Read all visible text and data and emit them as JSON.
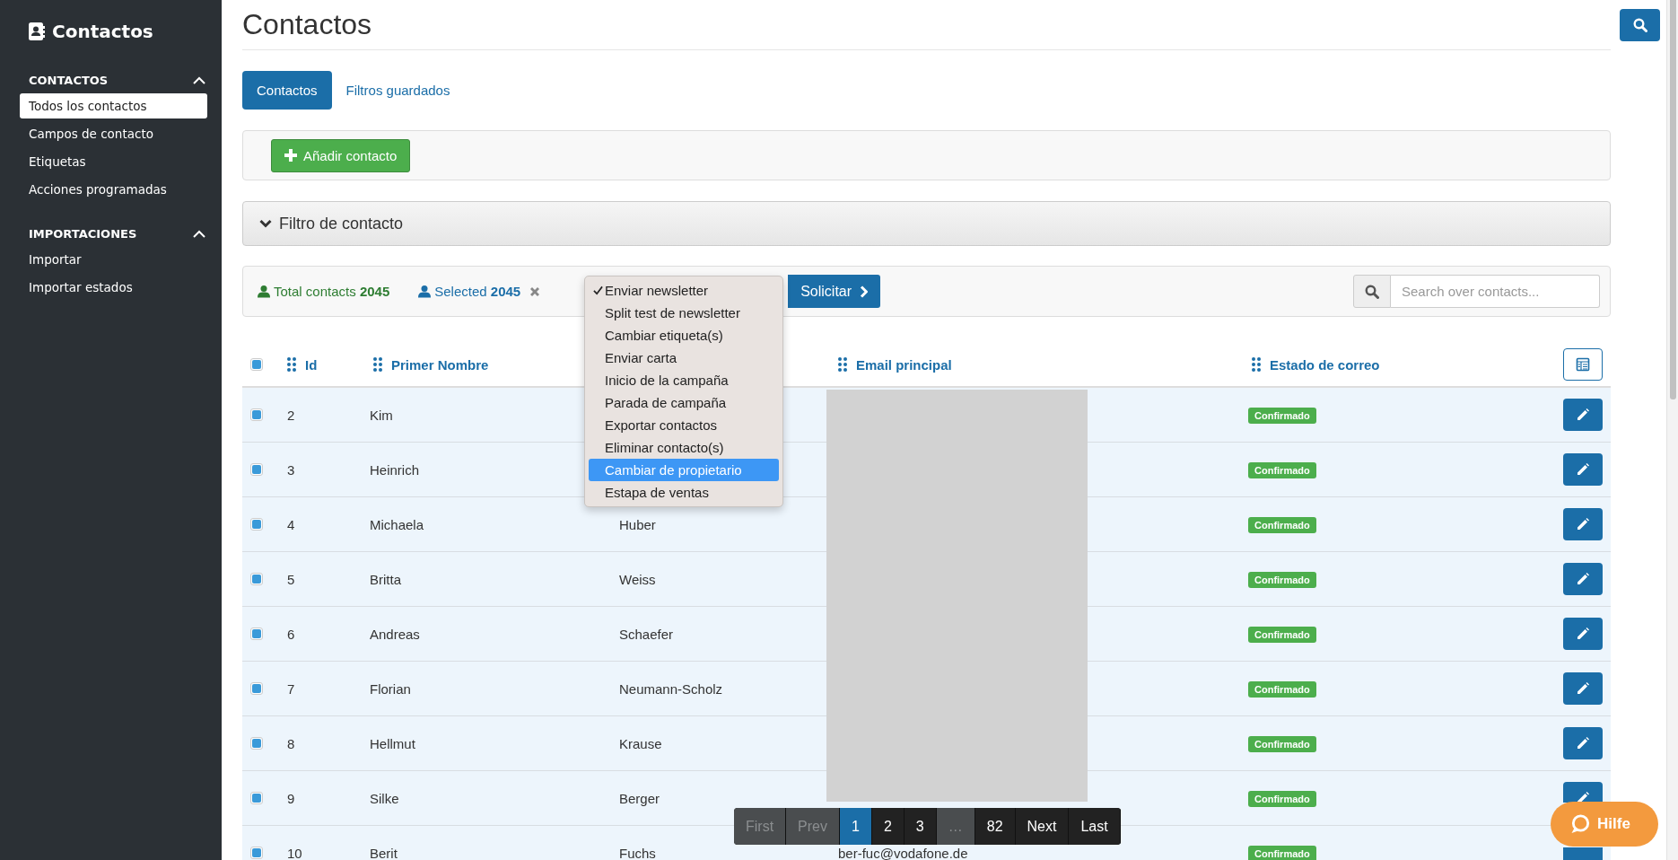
{
  "sidebar": {
    "title": "Contactos",
    "sections": [
      {
        "title": "CONTACTOS",
        "expanded": true,
        "items": [
          {
            "label": "Todos los contactos",
            "selected": true
          },
          {
            "label": "Campos de contacto",
            "selected": false
          },
          {
            "label": "Etiquetas",
            "selected": false
          },
          {
            "label": "Acciones programadas",
            "selected": false
          }
        ]
      },
      {
        "title": "IMPORTACIONES",
        "expanded": true,
        "items": [
          {
            "label": "Importar",
            "selected": false
          },
          {
            "label": "Importar estados",
            "selected": false
          }
        ]
      }
    ]
  },
  "page": {
    "title": "Contactos"
  },
  "tabs": [
    {
      "label": "Contactos",
      "selected": true
    },
    {
      "label": "Filtros guardados",
      "selected": false
    }
  ],
  "add_button": "Añadir contacto",
  "filter_panel": {
    "title": "Filtro de contacto",
    "expanded": false
  },
  "toolbar": {
    "total_label": "Total contacts",
    "total_count": "2045",
    "selected_label": "Selected",
    "selected_count": "2045",
    "apply_button": "Solicitar",
    "search": {
      "placeholder": "Search over contacts..."
    }
  },
  "action_menu": [
    {
      "label": "Enviar newsletter",
      "selected": true,
      "highlighted": false
    },
    {
      "label": "Split test de newsletter",
      "selected": false,
      "highlighted": false
    },
    {
      "label": "Cambiar etiqueta(s)",
      "selected": false,
      "highlighted": false
    },
    {
      "label": "Enviar carta",
      "selected": false,
      "highlighted": false
    },
    {
      "label": "Inicio de la campaña",
      "selected": false,
      "highlighted": false
    },
    {
      "label": "Parada de campaña",
      "selected": false,
      "highlighted": false
    },
    {
      "label": "Exportar contactos",
      "selected": false,
      "highlighted": false
    },
    {
      "label": "Eliminar contacto(s)",
      "selected": false,
      "highlighted": false
    },
    {
      "label": "Cambiar de propietario",
      "selected": false,
      "highlighted": true
    },
    {
      "label": "Estapa de ventas",
      "selected": false,
      "highlighted": false
    }
  ],
  "table": {
    "header": {
      "all_checked": true,
      "id": "Id",
      "first_name": "Primer Nombre",
      "email": "Email principal",
      "mail_status": "Estado de correo"
    },
    "rows": [
      {
        "checked": true,
        "id": "2",
        "first_name": "Kim",
        "status": "Confirmado"
      },
      {
        "checked": true,
        "id": "3",
        "first_name": "Heinrich",
        "status": "Confirmado"
      },
      {
        "checked": true,
        "id": "4",
        "first_name": "Michaela",
        "column_3": "Huber",
        "status": "Confirmado"
      },
      {
        "checked": true,
        "id": "5",
        "first_name": "Britta",
        "column_3": "Weiss",
        "status": "Confirmado"
      },
      {
        "checked": true,
        "id": "6",
        "first_name": "Andreas",
        "column_3": "Schaefer",
        "status": "Confirmado"
      },
      {
        "checked": true,
        "id": "7",
        "first_name": "Florian",
        "column_3": "Neumann-Scholz",
        "status": "Confirmado"
      },
      {
        "checked": true,
        "id": "8",
        "first_name": "Hellmut",
        "column_3": "Krause",
        "status": "Confirmado"
      },
      {
        "checked": true,
        "id": "9",
        "first_name": "Silke",
        "column_3": "Berger",
        "status": "Confirmado"
      },
      {
        "checked": true,
        "id": "10",
        "first_name": "Berit",
        "column_3": "Fuchs",
        "email": "ber-fuc@vodafone.de",
        "status": "Confirmado"
      }
    ]
  },
  "pagination": [
    {
      "label": "First",
      "disabled": true,
      "selected": false
    },
    {
      "label": "Prev",
      "disabled": true,
      "selected": false
    },
    {
      "label": "1",
      "disabled": false,
      "selected": true
    },
    {
      "label": "2",
      "disabled": false,
      "selected": false
    },
    {
      "label": "3",
      "disabled": false,
      "selected": false
    },
    {
      "label": "…",
      "disabled": true,
      "selected": false
    },
    {
      "label": "82",
      "disabled": false,
      "selected": false
    },
    {
      "label": "Next",
      "disabled": false,
      "selected": false
    },
    {
      "label": "Last",
      "disabled": false,
      "selected": false
    }
  ],
  "help_button": "Hilfe"
}
